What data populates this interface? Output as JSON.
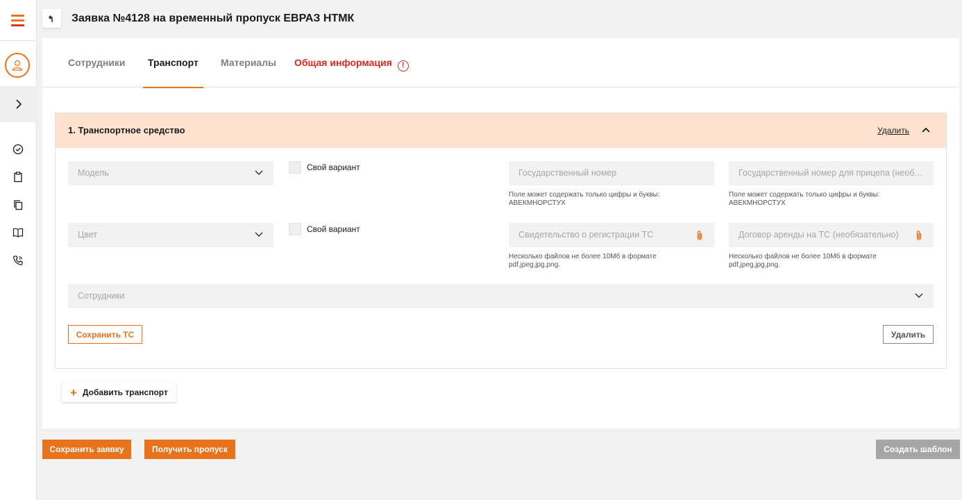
{
  "colors": {
    "accent": "#e8731c",
    "error": "#d9281e",
    "card_header_bg": "#fde3cf",
    "field_bg": "#f2f2f2"
  },
  "header": {
    "title": "Заявка №4128 на временный пропуск ЕВРАЗ НТМК",
    "back_icon": "back-arrow-icon"
  },
  "sidebar": {
    "icons": [
      "menu-icon",
      "user-icon",
      "chevron-right-icon",
      "check-circle-icon",
      "clipboard-icon",
      "copy-icon",
      "book-icon",
      "phone-icon"
    ]
  },
  "tabs": [
    {
      "label": "Сотрудники",
      "active": false
    },
    {
      "label": "Транспорт",
      "active": true
    },
    {
      "label": "Материалы",
      "active": false
    },
    {
      "label": "Общая информация",
      "active": false,
      "error": true,
      "error_mark": "!"
    }
  ],
  "vehicle": {
    "title": "1. Транспортное средство",
    "delete_link": "Удалить",
    "model": {
      "placeholder": "Модель",
      "custom_option": "Свой вариант"
    },
    "color": {
      "placeholder": "Цвет",
      "custom_option": "Свой вариант"
    },
    "plate": {
      "placeholder": "Государственный номер",
      "hint": "Поле может содержать только цифры и буквы: АВЕКМНОРСТУХ"
    },
    "trailer_plate": {
      "placeholder": "Государственный номер для прицепа (необязательно)",
      "hint": "Поле может содержать только цифры и буквы: АВЕКМНОРСТУХ"
    },
    "registration": {
      "placeholder": "Свидетельство о регистрации ТС",
      "hint": "Несколько файлов не более 10Мб в формате pdf,jpeg,jpg,png."
    },
    "lease": {
      "placeholder": "Договор аренды на ТС (необязательно)",
      "hint": "Несколько файлов не более 10Мб в формате pdf,jpeg,jpg,png."
    },
    "employees": {
      "placeholder": "Сотрудники"
    },
    "save_button": "Сохранить ТС",
    "delete_button": "Удалить"
  },
  "add_transport": {
    "plus": "+",
    "label": "Добавить транспорт"
  },
  "footer": {
    "save_request": "Сохранить заявку",
    "get_pass": "Получить пропуск",
    "create_template": "Создать шаблон"
  }
}
